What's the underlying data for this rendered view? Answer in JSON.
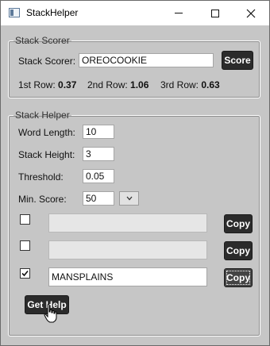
{
  "window": {
    "title": "StackHelper"
  },
  "scorer": {
    "legend": "Stack Scorer",
    "label": "Stack Scorer:",
    "value": "OREOCOOKIE",
    "score_button": "Score",
    "rows": [
      {
        "label": "1st Row:",
        "value": "0.37"
      },
      {
        "label": "2nd Row:",
        "value": "1.06"
      },
      {
        "label": "3rd Row:",
        "value": "0.63"
      }
    ]
  },
  "helper": {
    "legend": "Stack Helper",
    "fields": [
      {
        "label": "Word Length:",
        "value": "10"
      },
      {
        "label": "Stack Height:",
        "value": "3"
      },
      {
        "label": "Threshold:",
        "value": "0.05"
      },
      {
        "label": "Min. Score:",
        "value": "50"
      }
    ],
    "results": [
      {
        "checked": false,
        "text": "",
        "copy_label": "Copy"
      },
      {
        "checked": false,
        "text": "",
        "copy_label": "Copy"
      },
      {
        "checked": true,
        "text": "MANSPLAINS",
        "copy_label": "Copy"
      }
    ],
    "get_help_button": "Get Help"
  }
}
